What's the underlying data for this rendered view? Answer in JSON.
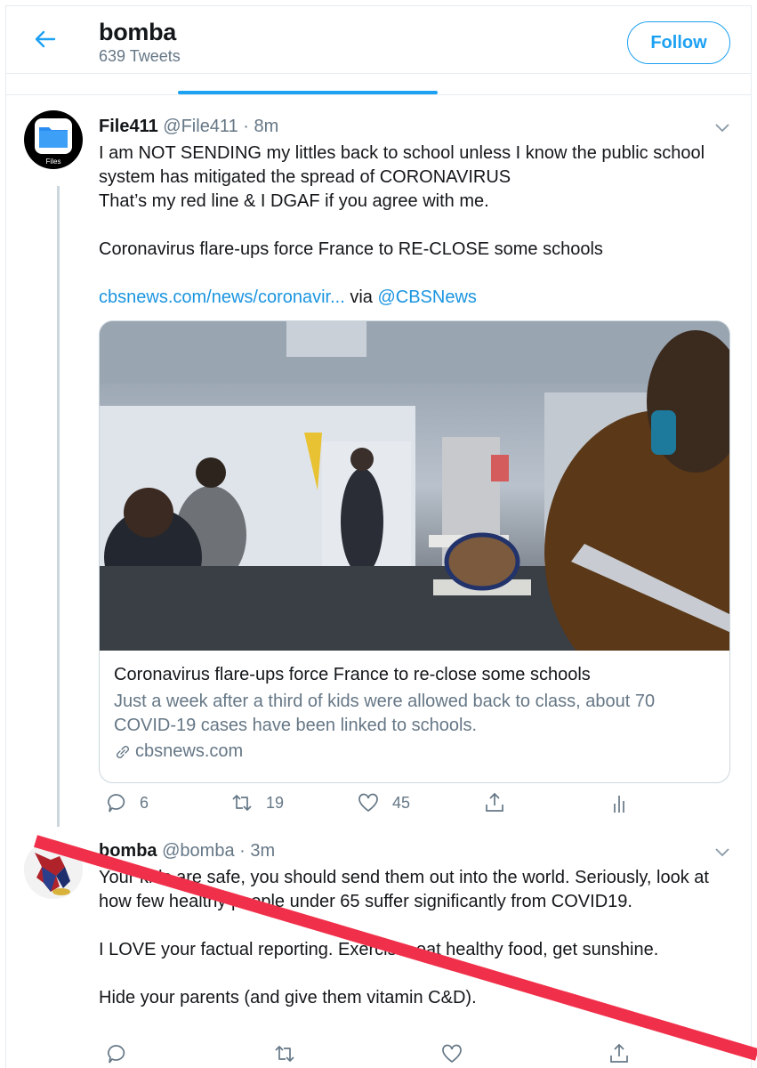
{
  "header": {
    "title": "bomba",
    "subtitle": "639 Tweets",
    "follow_label": "Follow",
    "back_icon": "arrow-left-icon"
  },
  "colors": {
    "accent": "#1da1f2",
    "link": "#1b95e0",
    "muted": "#657786",
    "border": "#e6ecf0",
    "strike": "#f0304a"
  },
  "tweets": [
    {
      "display_name": "File411",
      "handle": "@File411",
      "separator": "·",
      "time": "8m",
      "avatar_label": "Files",
      "avatar_icon": "folder-icon",
      "body_lines": [
        "I am NOT SENDING my littles back to school unless I know the public school system has mitigated the spread of CORONAVIRUS",
        "That’s my red line & I DGAF if you agree with me.",
        "",
        "Coronavirus flare-ups force France to RE-CLOSE some schools",
        ""
      ],
      "link_text": "cbsnews.com/news/coronavir...",
      "via_text": " via ",
      "via_handle": "@CBSNews",
      "card": {
        "image_alt": "classroom with masked students",
        "title": "Coronavirus flare-ups force France to re-close some schools",
        "description": "Just a week after a third of kids were allowed back to class, about 70 COVID-19 cases have been linked to schools.",
        "domain": "cbsnews.com",
        "domain_icon": "link-icon"
      },
      "actions": {
        "replies": "6",
        "retweets": "19",
        "likes": "45"
      }
    },
    {
      "display_name": "bomba",
      "handle": "@bomba",
      "separator": "·",
      "time": "3m",
      "body_lines": [
        "Your kids are safe, you should send them out into the world. Seriously, look at how few healthy people under 65 suffer significantly from COVID19.",
        "",
        "I LOVE your factual reporting. Exercise, eat healthy food, get sunshine.",
        "",
        "Hide your parents (and give them vitamin C&D)."
      ],
      "actions": {
        "replies": "",
        "retweets": "",
        "likes": ""
      }
    }
  ]
}
